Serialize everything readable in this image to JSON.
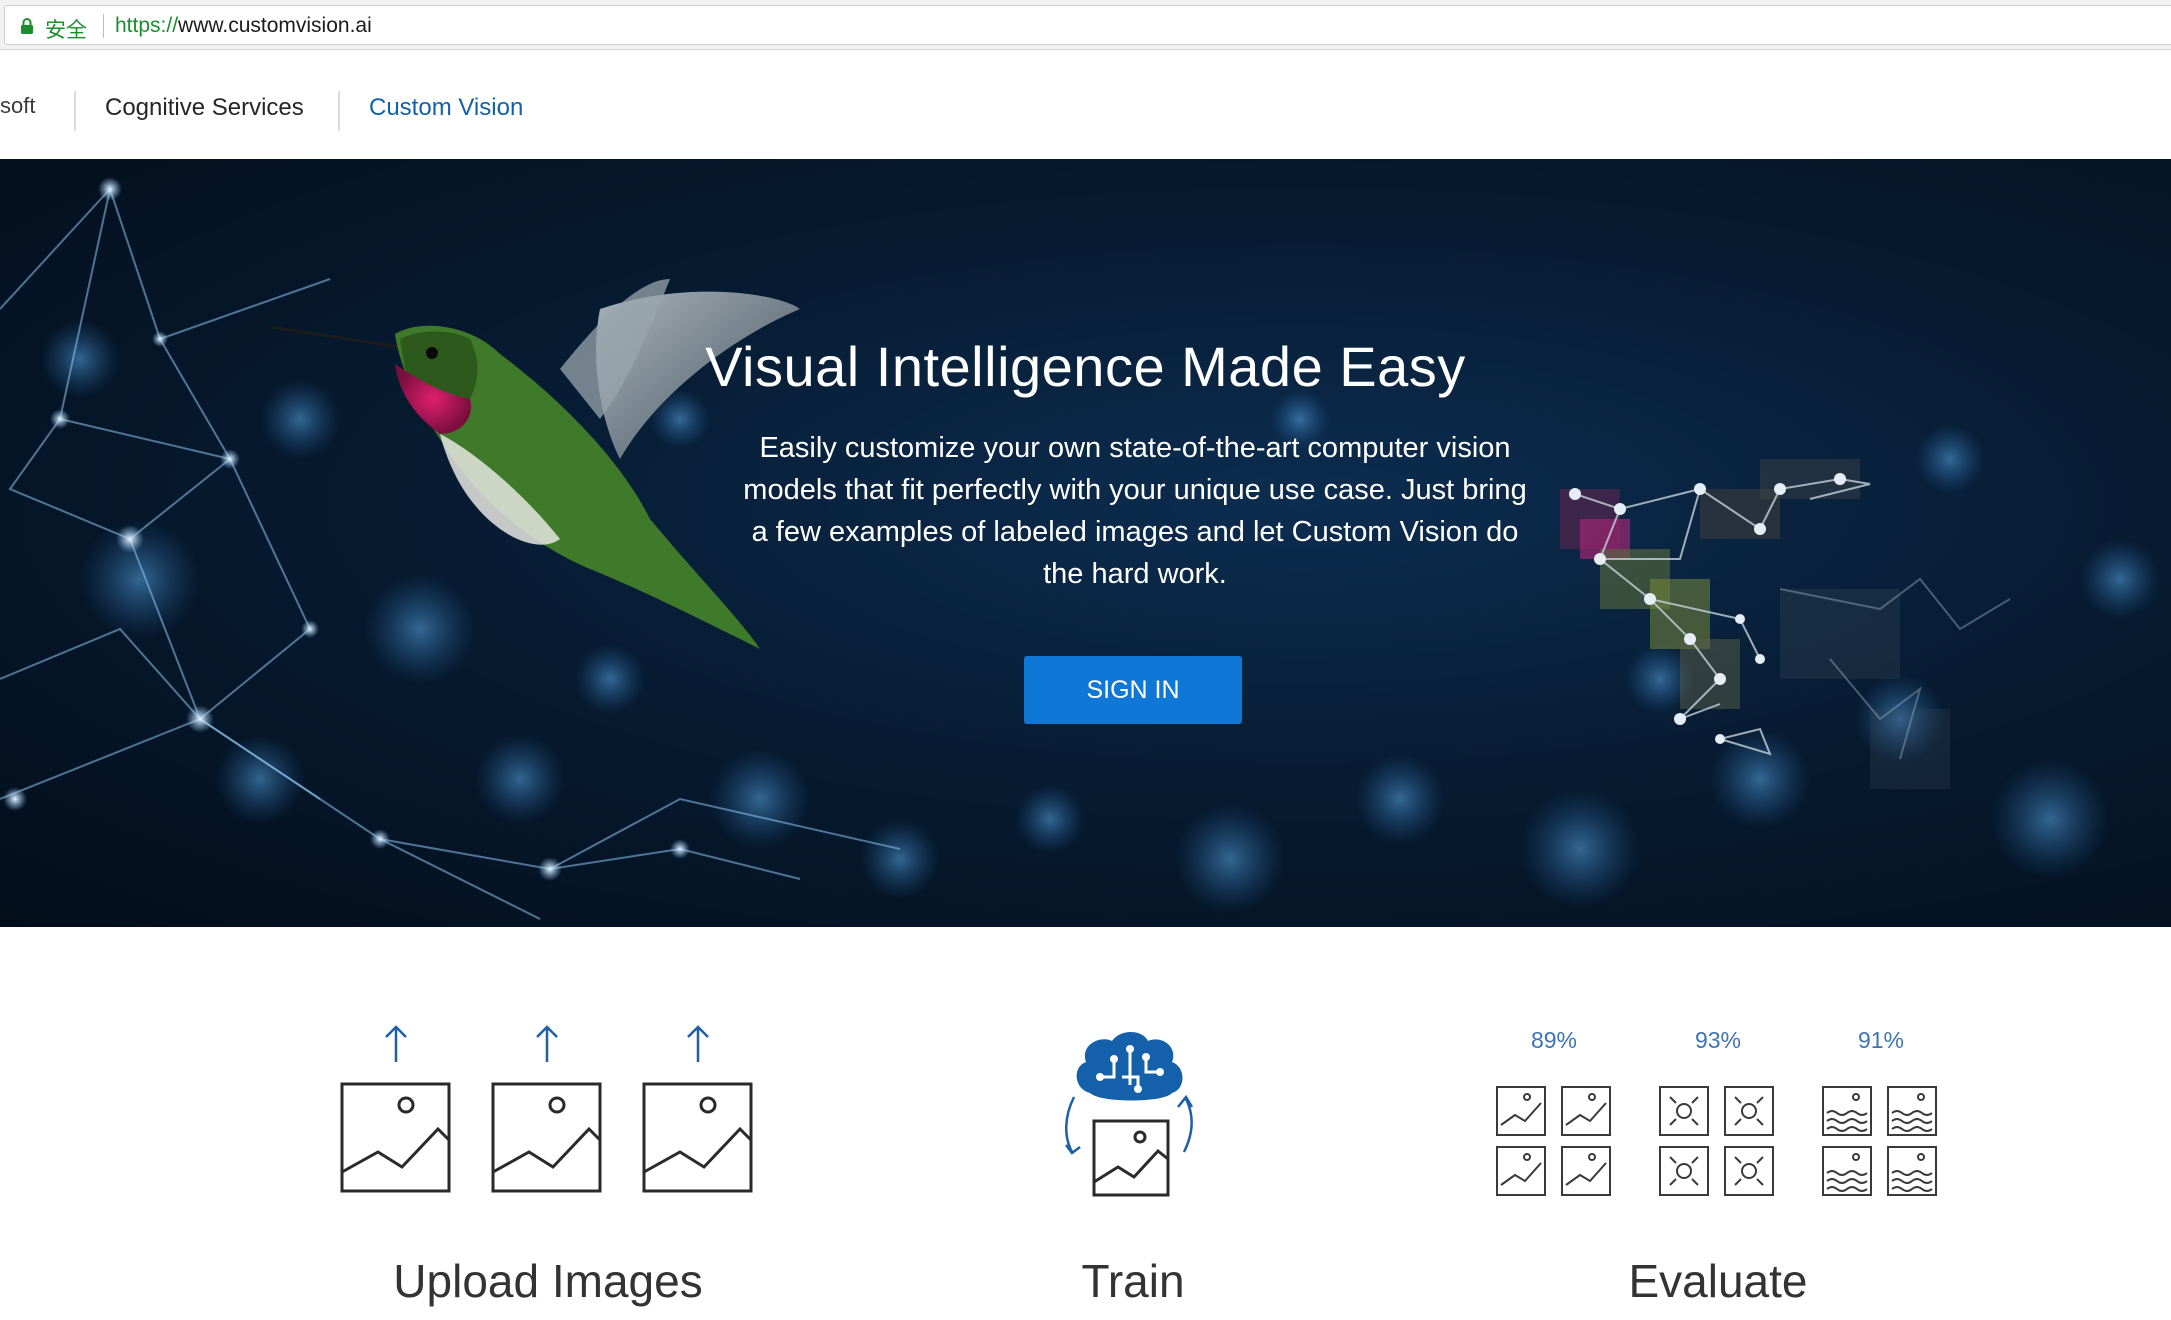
{
  "browser": {
    "security_label": "安全",
    "url_scheme": "https://",
    "url_rest": "www.customvision.ai"
  },
  "header": {
    "brand_fragment": "soft",
    "nav": [
      {
        "label": "Cognitive Services",
        "active": false
      },
      {
        "label": "Custom Vision",
        "active": true
      }
    ]
  },
  "hero": {
    "title": "Visual Intelligence Made Easy",
    "description": "Easily customize your own state-of-the-art computer vision models that fit perfectly with your unique use case. Just bring a few examples of labeled images and let Custom Vision do the hard work.",
    "signin_label": "SIGN IN"
  },
  "steps": [
    {
      "title": "Upload Images",
      "icon": "upload-images-icon"
    },
    {
      "title": "Train",
      "icon": "brain-circuit-icon"
    },
    {
      "title": "Evaluate",
      "icon": "evaluate-grid-icon"
    }
  ],
  "evaluate": {
    "scores": [
      "89%",
      "93%",
      "91%"
    ]
  },
  "colors": {
    "accent": "#0f78d6",
    "nav_active": "#1460aa",
    "secure_green": "#1b8f2e",
    "icon_blue": "#1460aa",
    "hero_bg": "#071c33"
  }
}
